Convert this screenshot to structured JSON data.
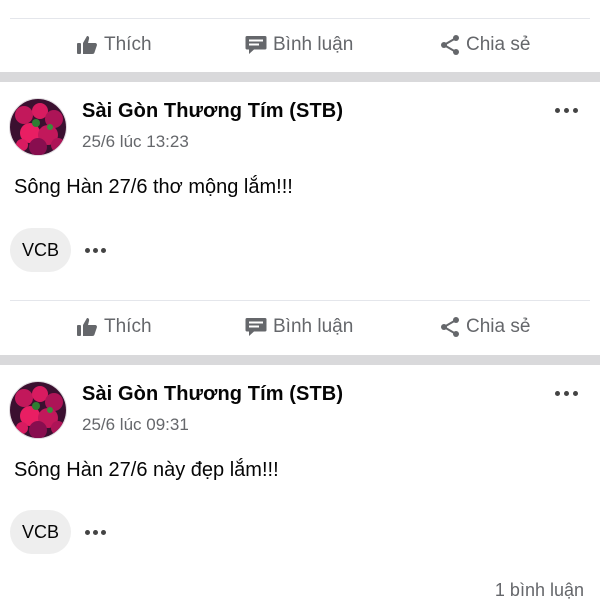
{
  "actions": {
    "like_label": "Thích",
    "comment_label": "Bình luận",
    "share_label": "Chia sẻ"
  },
  "posts": [
    {
      "author": "Sài Gòn Thương Tím (STB)",
      "timestamp": "25/6 lúc 13:23",
      "text": "Sông Hàn 27/6 thơ mộng lắm!!!",
      "tag": "VCB"
    },
    {
      "author": "Sài Gòn Thương Tím (STB)",
      "timestamp": "25/6 lúc 09:31",
      "text": "Sông Hàn 27/6 này đẹp lắm!!!",
      "tag": "VCB",
      "comment_count": "1 bình luận"
    }
  ],
  "colors": {
    "secondary_text": "#65676b",
    "separator": "#d9d9db",
    "chip_bg": "#eeeeee"
  }
}
